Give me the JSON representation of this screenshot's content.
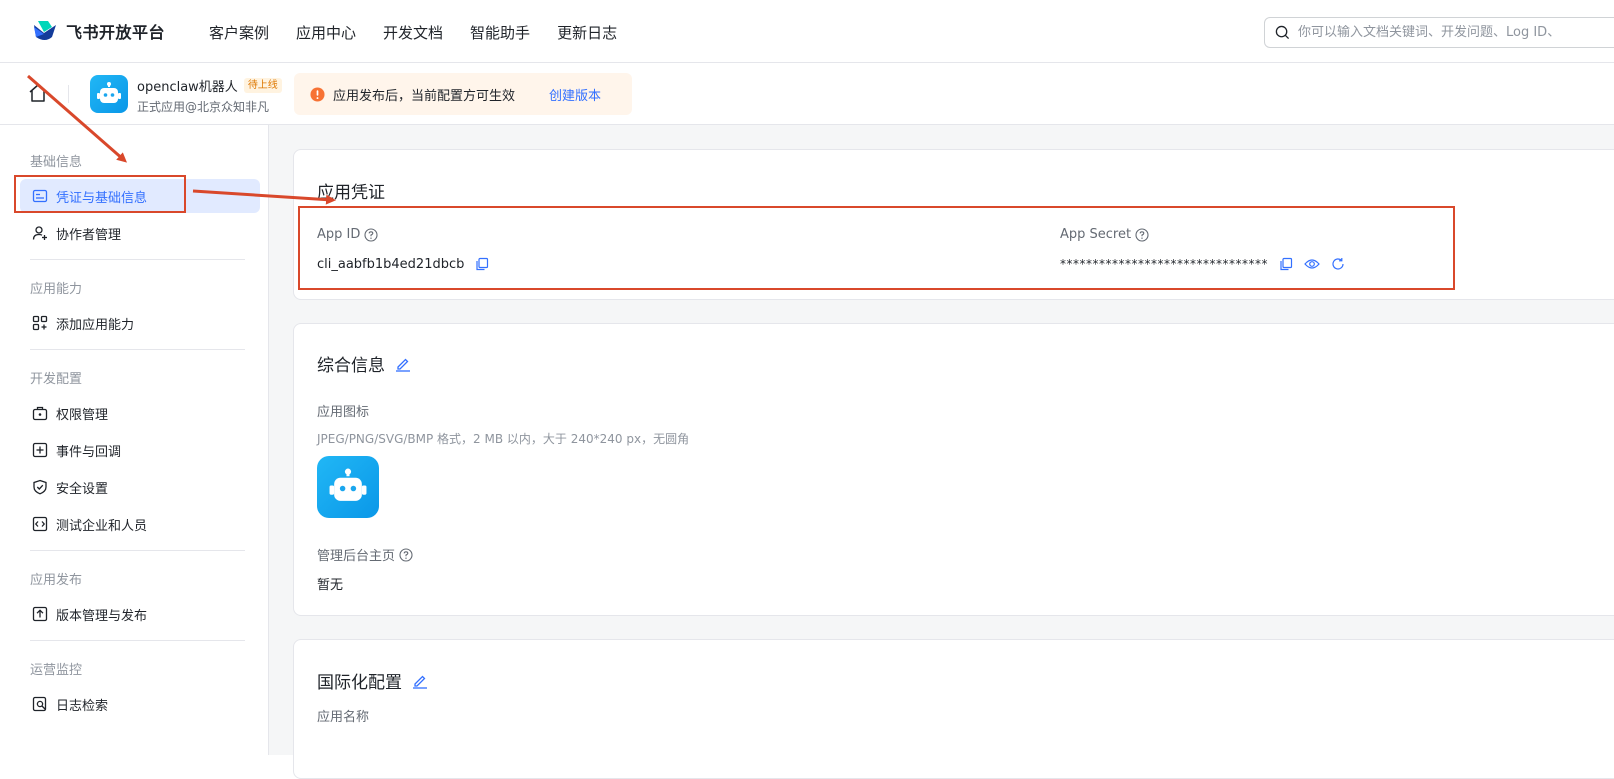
{
  "header": {
    "logo_text": "飞书开放平台",
    "nav": [
      "客户案例",
      "应用中心",
      "开发文档",
      "智能助手",
      "更新日志"
    ],
    "search_placeholder": "你可以输入文档关键词、开发问题、Log ID、"
  },
  "app": {
    "name": "openclaw机器人",
    "status_badge": "待上线",
    "subtitle": "正式应用@北京众知非凡",
    "notice_text": "应用发布后，当前配置方可生效",
    "notice_link": "创建版本"
  },
  "sidebar": {
    "groups": [
      {
        "title": "基础信息",
        "items": [
          "凭证与基础信息",
          "协作者管理"
        ]
      },
      {
        "title": "应用能力",
        "items": [
          "添加应用能力"
        ]
      },
      {
        "title": "开发配置",
        "items": [
          "权限管理",
          "事件与回调",
          "安全设置",
          "测试企业和人员"
        ]
      },
      {
        "title": "应用发布",
        "items": [
          "版本管理与发布"
        ]
      },
      {
        "title": "运营监控",
        "items": [
          "日志检索"
        ]
      }
    ]
  },
  "credentials": {
    "title": "应用凭证",
    "app_id_label": "App ID",
    "app_id_value": "cli_aabfb1b4ed21dbcb",
    "app_secret_label": "App Secret",
    "app_secret_value": "********************************"
  },
  "general": {
    "title": "综合信息",
    "icon_label": "应用图标",
    "icon_hint": "JPEG/PNG/SVG/BMP 格式，2 MB 以内，大于 240*240 px，无圆角",
    "admin_label": "管理后台主页",
    "admin_value": "暂无"
  },
  "i18n": {
    "title": "国际化配置",
    "app_name_label": "应用名称"
  },
  "colors": {
    "accent": "#3370ff",
    "annotation": "#d9482b",
    "warning": "#f77234"
  }
}
